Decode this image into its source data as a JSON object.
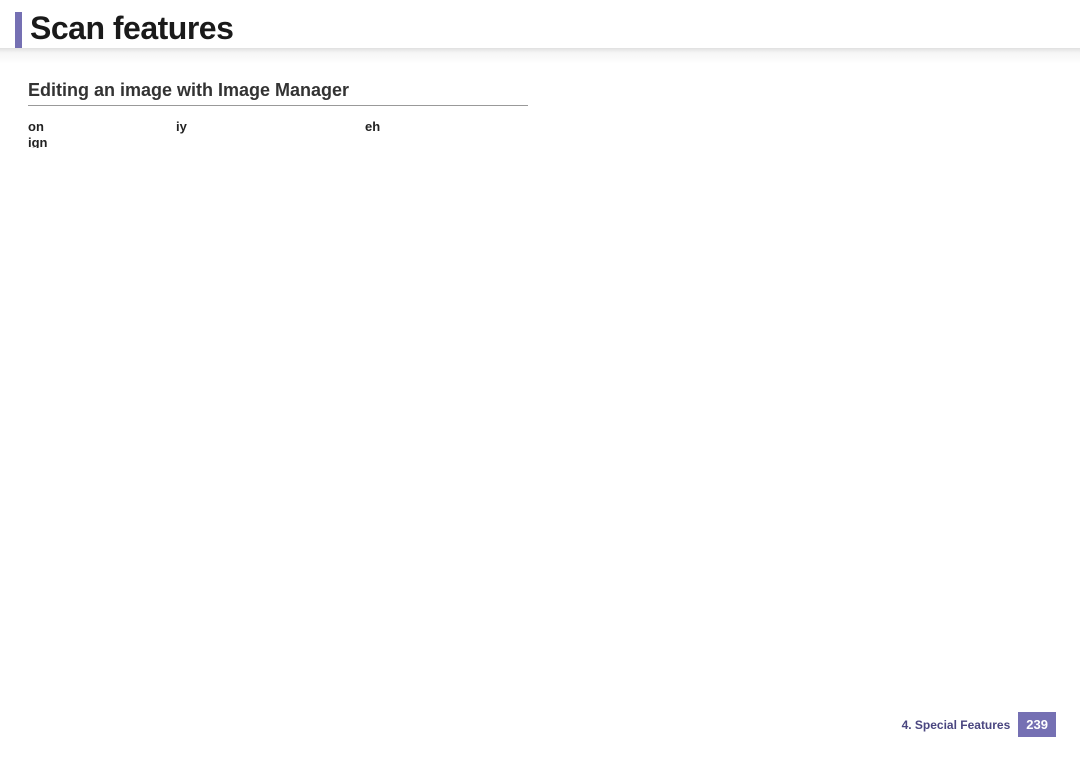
{
  "header": {
    "title": "Scan features"
  },
  "content": {
    "section_heading": "Editing an image with Image Manager",
    "body_line1_fragment1": "on",
    "body_line1_fragment2": "iy",
    "body_line1_fragment3": "eh",
    "body_line2_fragment1": "ign"
  },
  "footer": {
    "chapter_label": "4.  Special Features",
    "page_number": "239"
  }
}
